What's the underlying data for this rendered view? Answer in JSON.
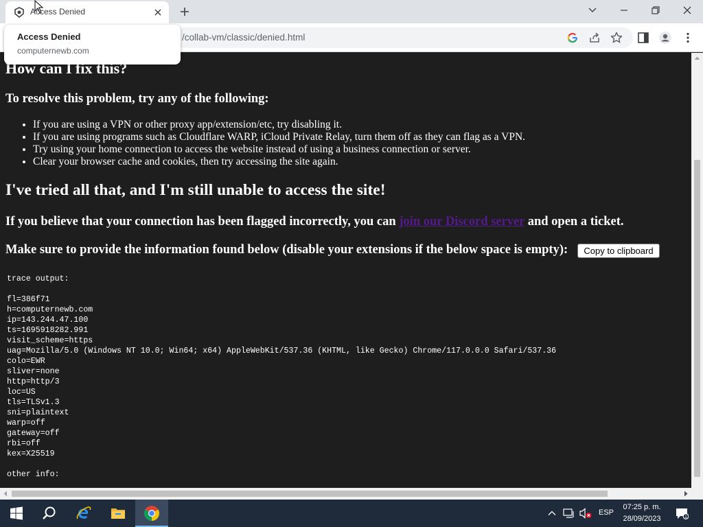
{
  "browser": {
    "tab_title": "Access Denied",
    "url": "/collab-vm/classic/denied.html",
    "hovercard": {
      "title": "Access Denied",
      "domain": "computernewb.com"
    }
  },
  "page": {
    "heading_fix": "How can I fix this?",
    "resolve_heading": "To resolve this problem, try any of the following:",
    "bullets": [
      "If you are using a VPN or other proxy app/extension/etc, try disabling it.",
      "If you are using programs such as Cloudflare WARP, iCloud Private Relay, turn them off as they can flag as a VPN.",
      "Try using your home connection to access the website instead of using a business connection or server.",
      "Clear your browser cache and cookies, then try accessing the site again."
    ],
    "tried_heading": "I've tried all that, and I'm still unable to access the site!",
    "believe_prefix": "If you believe that your connection has been flagged incorrectly, you can ",
    "discord_link": "join our Discord server",
    "believe_suffix": " and open a ticket.",
    "provide_text": "Make sure to provide the information found below (disable your extensions if the below space is empty):",
    "copy_button": "Copy to clipboard",
    "trace_output": "trace output:\n\nfl=386f71\nh=computernewb.com\nip=143.244.47.100\nts=1695918282.991\nvisit_scheme=https\nuag=Mozilla/5.0 (Windows NT 10.0; Win64; x64) AppleWebKit/537.36 (KHTML, like Gecko) Chrome/117.0.0.0 Safari/537.36\ncolo=EWR\nsliver=none\nhttp=http/3\nloc=US\ntls=TLSv1.3\nsni=plaintext\nwarp=off\ngateway=off\nrbi=off\nkex=X25519\n\nother info:"
  },
  "taskbar": {
    "language": "ESP",
    "time": "07:25 p. m.",
    "date": "28/09/2023"
  },
  "colors": {
    "page_bg": "#1e1e1e",
    "link": "#551a8b",
    "taskbar_bg": "#1f2a3a",
    "google_blue": "#4285f4"
  },
  "icons": [
    "tab-favicon-icon",
    "close-tab-icon",
    "new-tab-icon",
    "chevron-down-icon",
    "minimize-icon",
    "restore-icon",
    "close-window-icon",
    "google-icon",
    "share-icon",
    "star-icon",
    "sidepanel-icon",
    "profile-icon",
    "menu-dots-icon",
    "windows-start-icon",
    "search-icon",
    "internet-explorer-icon",
    "file-explorer-icon",
    "chrome-icon",
    "chevron-up-icon",
    "network-icon",
    "volume-muted-icon",
    "notification-icon"
  ]
}
